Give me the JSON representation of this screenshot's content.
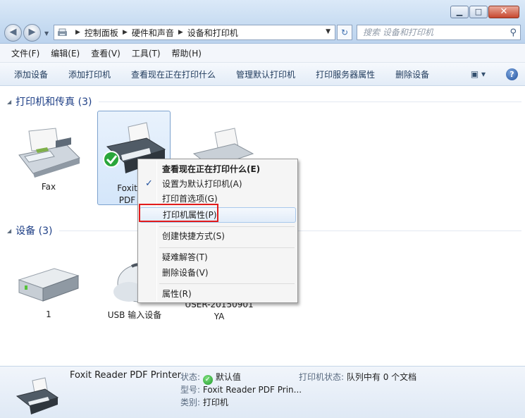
{
  "window": {
    "minimize_glyph": "▁",
    "maximize_glyph": "□",
    "close_glyph": "✕"
  },
  "nav": {
    "back_glyph": "◀",
    "forward_glyph": "▶",
    "recent_glyph": "▼"
  },
  "address": {
    "breadcrumbs": [
      "控制面板",
      "硬件和声音",
      "设备和打印机"
    ],
    "refresh_glyph": "↻"
  },
  "search": {
    "placeholder": "搜索 设备和打印机",
    "icon": "search-icon"
  },
  "menubar": {
    "items": [
      "文件(F)",
      "编辑(E)",
      "查看(V)",
      "工具(T)",
      "帮助(H)"
    ]
  },
  "toolbar": {
    "commands": [
      "添加设备",
      "添加打印机",
      "查看现在正在打印什么",
      "管理默认打印机",
      "打印服务器属性",
      "删除设备"
    ],
    "view_glyph": "▣ ▾",
    "help_glyph": "?"
  },
  "groups": {
    "printers": {
      "title": "打印机和传真 (3)",
      "items": [
        {
          "label": "Fax"
        },
        {
          "label_line1": "Foxit Re",
          "label_line2": "PDF Pri"
        }
      ]
    },
    "devices": {
      "title": "设备 (3)",
      "items": [
        {
          "label": "1"
        },
        {
          "label": "USB 输入设备"
        },
        {
          "label_line1": "USER-20150901",
          "label_line2": "YA"
        }
      ]
    }
  },
  "context_menu": {
    "items": [
      {
        "label": "查看现在正在打印什么(E)",
        "bold": true
      },
      {
        "label": "设置为默认打印机(A)",
        "checked": true
      },
      {
        "label": "打印首选项(G)"
      },
      {
        "label": "打印机属性(P)",
        "highlighted": true
      },
      {
        "label": "创建快捷方式(S)"
      },
      {
        "label": "疑难解答(T)"
      },
      {
        "label": "删除设备(V)"
      },
      {
        "label": "属性(R)"
      }
    ],
    "check_glyph": "✓"
  },
  "details": {
    "name": "Foxit Reader PDF Printer",
    "status_label": "状态:",
    "status_value": "默认值",
    "model_label": "型号:",
    "model_value": "Foxit Reader PDF Prin...",
    "category_label": "类别:",
    "category_value": "打印机",
    "printer_status_label": "打印机状态:",
    "printer_status_value": "队列中有 0 个文档"
  },
  "colors": {
    "highlight_box": "#e21b1b",
    "group_title": "#1e3f86",
    "selection": "#d4e6fa"
  }
}
